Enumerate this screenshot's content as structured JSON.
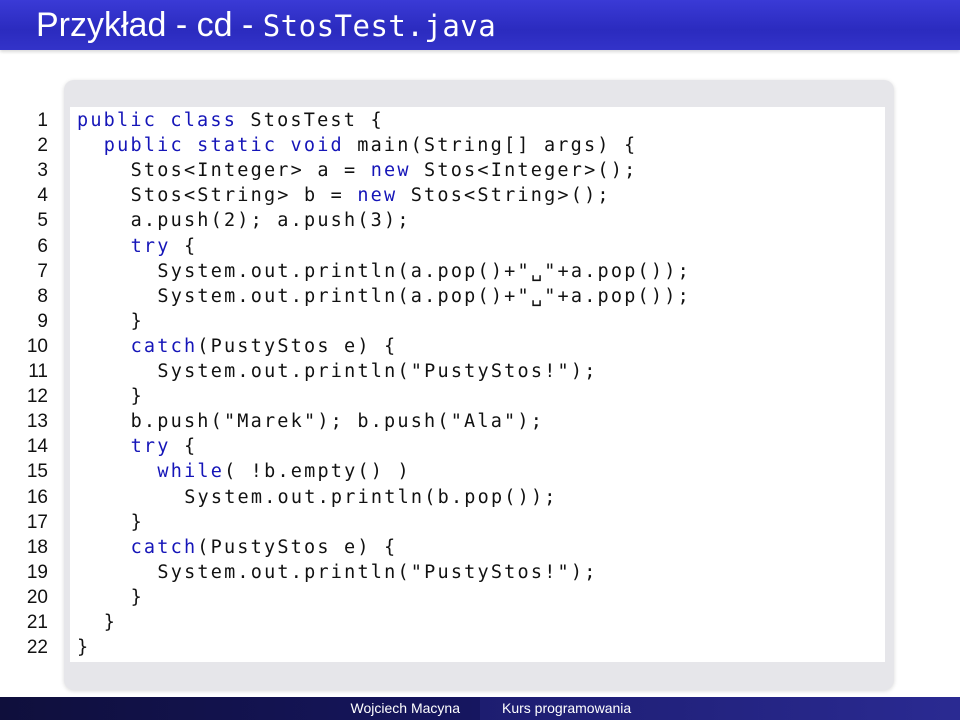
{
  "slide": {
    "title_prefix": "Przykład - cd - ",
    "title_file": "StosTest.java"
  },
  "colors": {
    "title_bar": "#2b2bbf",
    "keyword": "#1515b8",
    "code_frame": "#e6e6ea",
    "footer": "#1a1a5a"
  },
  "code": {
    "lines": [
      {
        "n": "1",
        "indent": 0,
        "parts": [
          [
            "kw",
            "public class"
          ],
          [
            "t",
            " StosTest {"
          ]
        ]
      },
      {
        "n": "2",
        "indent": 1,
        "parts": [
          [
            "kw",
            "public static void"
          ],
          [
            "t",
            " main(String[] args) {"
          ]
        ]
      },
      {
        "n": "3",
        "indent": 2,
        "parts": [
          [
            "t",
            "Stos<Integer> a = "
          ],
          [
            "kw",
            "new"
          ],
          [
            "t",
            " Stos<Integer>();"
          ]
        ]
      },
      {
        "n": "4",
        "indent": 2,
        "parts": [
          [
            "t",
            "Stos<String> b = "
          ],
          [
            "kw",
            "new"
          ],
          [
            "t",
            " Stos<String>();"
          ]
        ]
      },
      {
        "n": "5",
        "indent": 2,
        "parts": [
          [
            "t",
            "a.push(2); a.push(3);"
          ]
        ]
      },
      {
        "n": "6",
        "indent": 2,
        "parts": [
          [
            "kw",
            "try"
          ],
          [
            "t",
            " {"
          ]
        ]
      },
      {
        "n": "7",
        "indent": 3,
        "parts": [
          [
            "t",
            "System.out.println(a.pop()+\"␣\"+a.pop());"
          ]
        ]
      },
      {
        "n": "8",
        "indent": 3,
        "parts": [
          [
            "t",
            "System.out.println(a.pop()+\"␣\"+a.pop());"
          ]
        ]
      },
      {
        "n": "9",
        "indent": 2,
        "parts": [
          [
            "t",
            "}"
          ]
        ]
      },
      {
        "n": "10",
        "indent": 2,
        "parts": [
          [
            "kw",
            "catch"
          ],
          [
            "t",
            "(PustyStos e) {"
          ]
        ]
      },
      {
        "n": "11",
        "indent": 3,
        "parts": [
          [
            "t",
            "System.out.println(\"PustyStos!\");"
          ]
        ]
      },
      {
        "n": "12",
        "indent": 2,
        "parts": [
          [
            "t",
            "}"
          ]
        ]
      },
      {
        "n": "13",
        "indent": 2,
        "parts": [
          [
            "t",
            "b.push(\"Marek\"); b.push(\"Ala\");"
          ]
        ]
      },
      {
        "n": "14",
        "indent": 2,
        "parts": [
          [
            "kw",
            "try"
          ],
          [
            "t",
            " {"
          ]
        ]
      },
      {
        "n": "15",
        "indent": 3,
        "parts": [
          [
            "kw",
            "while"
          ],
          [
            "t",
            "( !b.empty() )"
          ]
        ]
      },
      {
        "n": "16",
        "indent": 4,
        "parts": [
          [
            "t",
            "System.out.println(b.pop());"
          ]
        ]
      },
      {
        "n": "17",
        "indent": 2,
        "parts": [
          [
            "t",
            "}"
          ]
        ]
      },
      {
        "n": "18",
        "indent": 2,
        "parts": [
          [
            "kw",
            "catch"
          ],
          [
            "t",
            "(PustyStos e) {"
          ]
        ]
      },
      {
        "n": "19",
        "indent": 3,
        "parts": [
          [
            "t",
            "System.out.println(\"PustyStos!\");"
          ]
        ]
      },
      {
        "n": "20",
        "indent": 2,
        "parts": [
          [
            "t",
            "}"
          ]
        ]
      },
      {
        "n": "21",
        "indent": 1,
        "parts": [
          [
            "t",
            "}"
          ]
        ]
      },
      {
        "n": "22",
        "indent": 0,
        "parts": [
          [
            "t",
            "}"
          ]
        ]
      }
    ]
  },
  "footer": {
    "author": "Wojciech Macyna",
    "course": "Kurs programowania"
  }
}
